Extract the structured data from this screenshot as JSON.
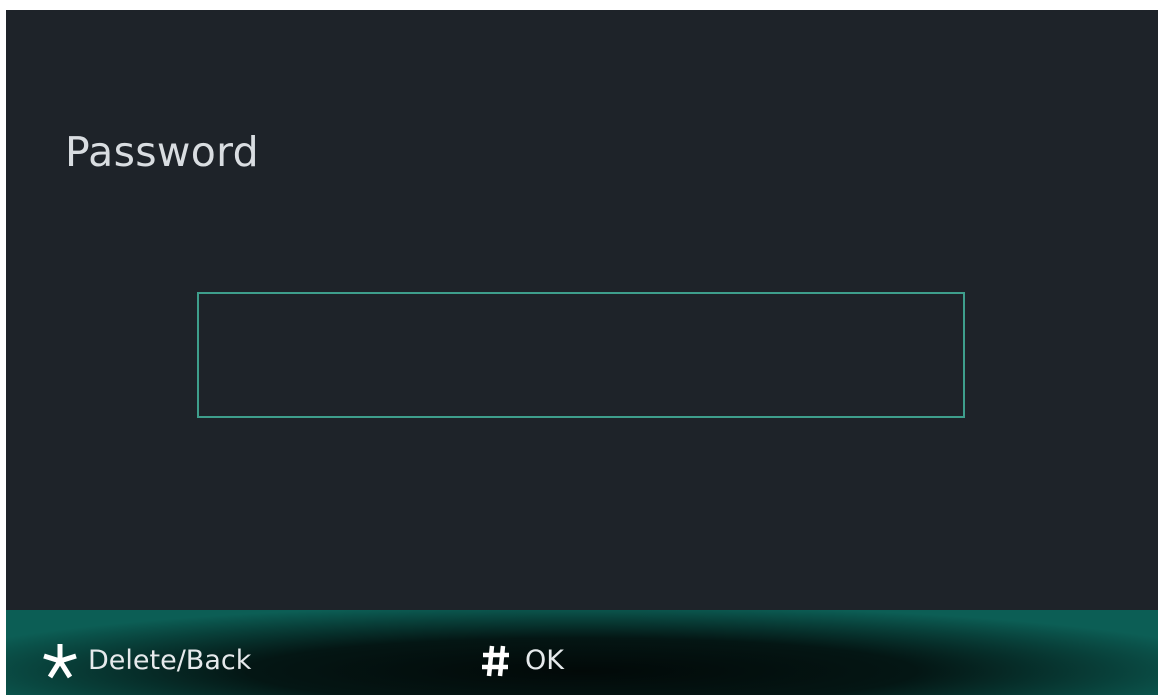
{
  "screen": {
    "title": "Password",
    "password_field": {
      "value": "",
      "placeholder": ""
    }
  },
  "footer": {
    "delete_hint": {
      "icon": "asterisk-icon",
      "label": "Delete/Back"
    },
    "ok_hint": {
      "icon": "hash-icon",
      "label": "OK"
    }
  },
  "colors": {
    "background": "#1e2329",
    "accent": "#3e9e8c",
    "footer": "#0c5e55",
    "text": "#d9dde1"
  }
}
